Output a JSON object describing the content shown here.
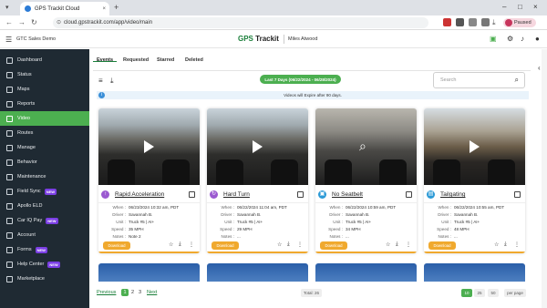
{
  "browser": {
    "tab_title": "GPS Trackit Cloud",
    "tab_close": "×",
    "new_tab": "+",
    "url": "cloud.gpstrackit.com/app/video/main",
    "profile_status": "Paused",
    "window_min": "–",
    "window_max": "□",
    "window_close": "×"
  },
  "header": {
    "company": "GTC Sales Demo",
    "brand_gps": "GPS",
    "brand_rest": " Trackit",
    "user": "Miles Atwood"
  },
  "sidebar": {
    "items": [
      {
        "label": "Dashboard"
      },
      {
        "label": "Status"
      },
      {
        "label": "Maps"
      },
      {
        "label": "Reports"
      },
      {
        "label": "Video"
      },
      {
        "label": "Routes"
      },
      {
        "label": "Manage"
      },
      {
        "label": "Behavior"
      },
      {
        "label": "Maintenance"
      },
      {
        "label": "Field Sync",
        "badge": "NEW"
      },
      {
        "label": "Apollo ELD"
      },
      {
        "label": "Car IQ Pay",
        "badge": "NEW"
      },
      {
        "label": "Account"
      },
      {
        "label": "Forms",
        "badge": "NEW"
      },
      {
        "label": "Help Center",
        "badge": "NEW"
      },
      {
        "label": "Marketplace"
      }
    ],
    "active_label": "Video"
  },
  "tabs": [
    "Events",
    "Requested",
    "Starred",
    "Deleted"
  ],
  "active_tab": "Events",
  "date_filter": "Last 7 Days (06/22/2024 - 06/28/2024)",
  "search": {
    "placeholder": "Search"
  },
  "info_text": "Videos will Expire after 90 days.",
  "info_icon": "i",
  "labels": {
    "when": "When :",
    "driver": "Driver :",
    "unit": "Unit :",
    "speed": "Speed :",
    "notes": "Notes :",
    "download": "Download"
  },
  "events": [
    {
      "name": "Rapid Acceleration",
      "icon_color": "#9b59d0",
      "when": "06/23/2024 10:32 am, PDT",
      "driver": "Savannah B.",
      "unit": "Truck #5 | AI+",
      "speed": "35 MPH",
      "notes": "Note 2"
    },
    {
      "name": "Hard Turn",
      "icon_color": "#9b59d0",
      "when": "06/22/2024 11:04 am, PDT",
      "driver": "Savannah B.",
      "unit": "Truck #5 | AI+",
      "speed": "29 MPH",
      "notes": "..."
    },
    {
      "name": "No Seatbelt",
      "icon_color": "#2c9ad6",
      "when": "06/22/2024 10:59 am, PDT",
      "driver": "Savannah B.",
      "unit": "Truck #5 | AI+",
      "speed": "34 MPH",
      "notes": "..."
    },
    {
      "name": "Tailgating",
      "icon_color": "#2c9ad6",
      "when": "06/22/2024 10:55 am, PDT",
      "driver": "Savannah B.",
      "unit": "Truck #5 | AI+",
      "speed": "48 MPH",
      "notes": "..."
    }
  ],
  "pagination": {
    "previous": "Previous",
    "pages": [
      "1",
      "2",
      "3"
    ],
    "active_page": "1",
    "next": "Next",
    "total": "Total: 26",
    "per_page_options": [
      "10",
      "25",
      "50"
    ],
    "per_page_active": "10",
    "per_page_label": "per page"
  }
}
